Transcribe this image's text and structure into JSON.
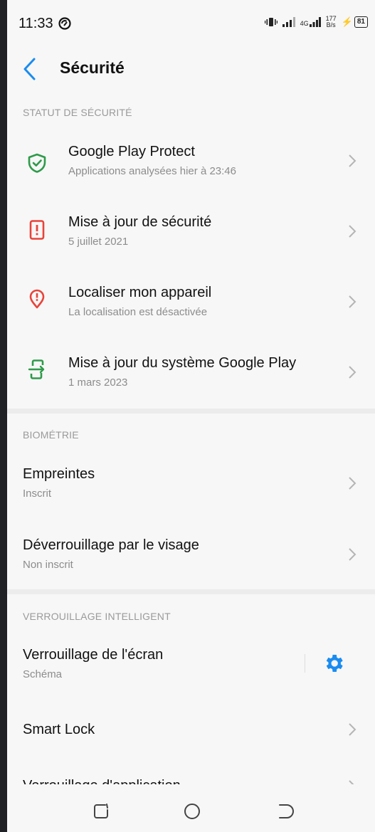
{
  "status_bar": {
    "time": "11:33",
    "net_type": "4G",
    "net_speed_value": "177",
    "net_speed_unit": "B/s",
    "battery_level": "81"
  },
  "header": {
    "title": "Sécurité"
  },
  "sections": {
    "security_status": {
      "label": "STATUT DE SÉCURITÉ",
      "items": [
        {
          "title": "Google Play Protect",
          "subtitle": "Applications analysées hier à 23:46",
          "icon": "shield-check-icon"
        },
        {
          "title": "Mise à jour de sécurité",
          "subtitle": "5 juillet 2021",
          "icon": "phone-alert-icon"
        },
        {
          "title": "Localiser mon appareil",
          "subtitle": "La localisation est désactivée",
          "icon": "location-alert-icon"
        },
        {
          "title": "Mise à jour du système Google Play",
          "subtitle": "1 mars 2023",
          "icon": "phone-update-icon"
        }
      ]
    },
    "biometrics": {
      "label": "BIOMÉTRIE",
      "items": [
        {
          "title": "Empreintes",
          "subtitle": "Inscrit"
        },
        {
          "title": "Déverrouillage par le visage",
          "subtitle": "Non inscrit"
        }
      ]
    },
    "smart_lock": {
      "label": "VERROUILLAGE INTELLIGENT",
      "items": [
        {
          "title": "Verrouillage de l'écran",
          "subtitle": "Schéma"
        },
        {
          "title": "Smart Lock",
          "subtitle": ""
        },
        {
          "title": "Verrouillage d'application",
          "subtitle": ""
        }
      ]
    }
  },
  "colors": {
    "accent_blue": "#1a8cf0",
    "green": "#2e9b4a",
    "red": "#e8443a"
  }
}
